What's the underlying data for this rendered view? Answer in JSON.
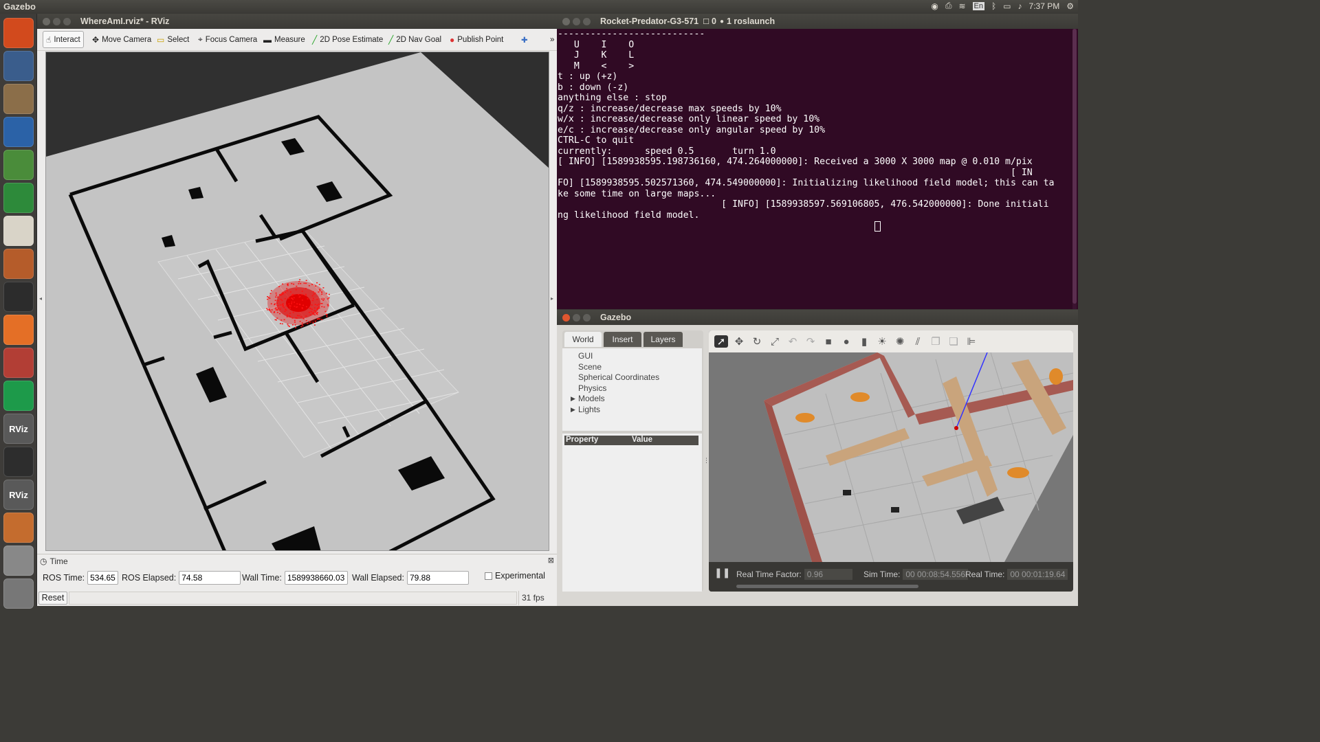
{
  "topbar": {
    "app_name": "Gazebo",
    "time": "7:37 PM",
    "keyboard": "En"
  },
  "launcher": {
    "items": [
      {
        "name": "ubuntu-dash-icon",
        "color": "#d24a1d"
      },
      {
        "name": "matlab-icon",
        "color": "#3a5d8c"
      },
      {
        "name": "files-icon",
        "color": "#8b6e49"
      },
      {
        "name": "writer-icon",
        "color": "#2b62a7"
      },
      {
        "name": "chrome-icon",
        "color": "#4a8c3a"
      },
      {
        "name": "calc-icon",
        "color": "#2d8a3a"
      },
      {
        "name": "amazon-icon",
        "color": "#d9d4c8"
      },
      {
        "name": "impress-icon",
        "color": "#b55c2a"
      },
      {
        "name": "terminal-icon",
        "color": "#2c2c2c"
      },
      {
        "name": "software-center-icon",
        "color": "#e46f26"
      },
      {
        "name": "settings-icon",
        "color": "#b23e35"
      },
      {
        "name": "spotify-icon",
        "color": "#1d9a4a"
      },
      {
        "name": "rviz-icon",
        "color": "#595959",
        "label": "RViz"
      },
      {
        "name": "obs-icon",
        "color": "#2d2d2d"
      },
      {
        "name": "rviz-icon-2",
        "color": "#595959",
        "label": "RViz"
      },
      {
        "name": "gazebo-icon",
        "color": "#c46c2e"
      },
      {
        "name": "drive-icon",
        "color": "#888"
      },
      {
        "name": "trash-icon",
        "color": "#777"
      }
    ]
  },
  "rviz": {
    "title": "WhereAmI.rviz* - RViz",
    "tools": [
      "Interact",
      "Move Camera",
      "Select",
      "Focus Camera",
      "Measure",
      "2D Pose Estimate",
      "2D Nav Goal",
      "Publish Point"
    ],
    "time_panel": {
      "header": "Time",
      "ros_time_label": "ROS Time:",
      "ros_time": "534.65",
      "ros_elapsed_label": "ROS Elapsed:",
      "ros_elapsed": "74.58",
      "wall_time_label": "Wall Time:",
      "wall_time": "1589938660.03",
      "wall_elapsed_label": "Wall Elapsed:",
      "wall_elapsed": "79.88",
      "experimental": "Experimental",
      "reset": "Reset",
      "fps": "31 fps"
    }
  },
  "terminal": {
    "title": "Rocket-Predator-G3-571",
    "title_extra": "0",
    "title_tab": "1 roslaunch",
    "lines": [
      "---------------------------",
      "   U    I    O",
      "   J    K    L",
      "   M    <    >",
      "",
      "t : up (+z)",
      "b : down (-z)",
      "",
      "anything else : stop",
      "",
      "q/z : increase/decrease max speeds by 10%",
      "w/x : increase/decrease only linear speed by 10%",
      "e/c : increase/decrease only angular speed by 10%",
      "",
      "CTRL-C to quit",
      "",
      "currently:      speed 0.5       turn 1.0",
      "[ INFO] [1589938595.198736160, 474.264000000]: Received a 3000 X 3000 map @ 0.010 m/pix",
      "                                                                                   [ IN",
      "FO] [1589938595.502571360, 474.549000000]: Initializing likelihood field model; this can ta",
      "ke some time on large maps...",
      "                              [ INFO] [1589938597.569106805, 476.542000000]: Done initiali",
      "ng likelihood field model."
    ]
  },
  "gazebo": {
    "title": "Gazebo",
    "tabs": [
      "World",
      "Insert",
      "Layers"
    ],
    "tree": [
      "GUI",
      "Scene",
      "Spherical Coordinates",
      "Physics",
      "Models",
      "Lights"
    ],
    "prop_header": "Property",
    "value_header": "Value",
    "status": {
      "rtf_label": "Real Time Factor:",
      "rtf": "0.96",
      "sim_label": "Sim Time:",
      "sim": "00 00:08:54.556",
      "real_label": "Real Time:",
      "real": "00 00:01:19.64"
    }
  }
}
